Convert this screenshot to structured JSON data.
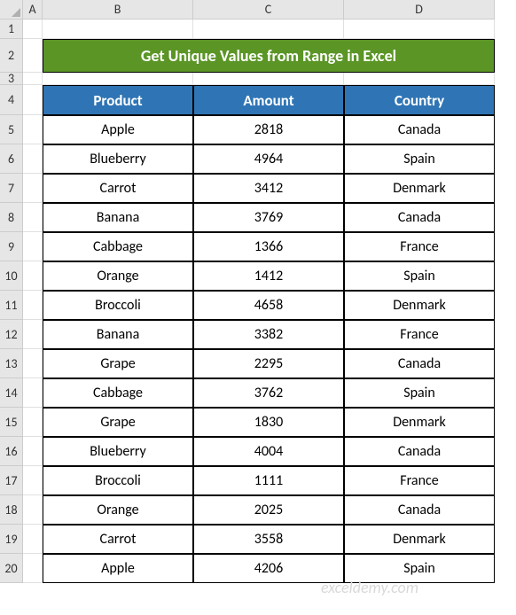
{
  "columns": [
    "A",
    "B",
    "C",
    "D"
  ],
  "rowNumbers": [
    1,
    2,
    3,
    4,
    5,
    6,
    7,
    8,
    9,
    10,
    11,
    12,
    13,
    14,
    15,
    16,
    17,
    18,
    19,
    20
  ],
  "title": "Get Unique Values from Range in Excel",
  "headers": [
    "Product",
    "Amount",
    "Country"
  ],
  "rows": [
    [
      "Apple",
      "2818",
      "Canada"
    ],
    [
      "Blueberry",
      "4964",
      "Spain"
    ],
    [
      "Carrot",
      "3412",
      "Denmark"
    ],
    [
      "Banana",
      "3769",
      "Canada"
    ],
    [
      "Cabbage",
      "1366",
      "France"
    ],
    [
      "Orange",
      "1412",
      "Spain"
    ],
    [
      "Broccoli",
      "4658",
      "Denmark"
    ],
    [
      "Banana",
      "3382",
      "France"
    ],
    [
      "Grape",
      "2295",
      "Canada"
    ],
    [
      "Cabbage",
      "3762",
      "Spain"
    ],
    [
      "Grape",
      "1830",
      "Denmark"
    ],
    [
      "Blueberry",
      "4004",
      "Canada"
    ],
    [
      "Broccoli",
      "1111",
      "France"
    ],
    [
      "Orange",
      "2025",
      "Canada"
    ],
    [
      "Carrot",
      "3558",
      "Denmark"
    ],
    [
      "Apple",
      "4206",
      "Spain"
    ]
  ],
  "watermark": "exceldemy.com"
}
